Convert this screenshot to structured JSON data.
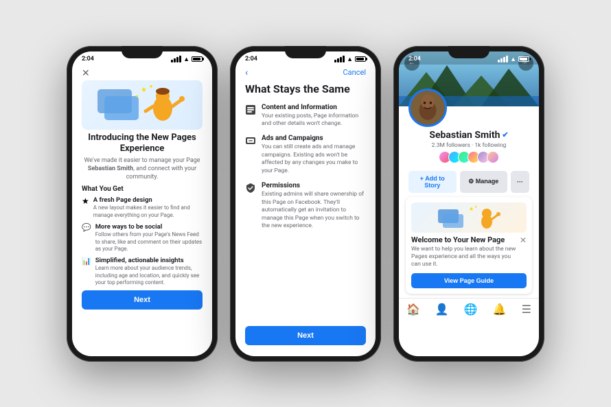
{
  "background": "#e8e8e8",
  "phone1": {
    "time": "2:04",
    "close_icon": "✕",
    "title": "Introducing the New Pages Experience",
    "subtitle_parts": [
      "We've made it easier to manage your Page",
      " Sebastian Smith",
      ", and connect with your community."
    ],
    "section_heading": "What You Get",
    "features": [
      {
        "icon": "★",
        "title": "A fresh Page design",
        "desc": "A new layout makes it easier to find and manage everything on your Page."
      },
      {
        "icon": "💬",
        "title": "More ways to be social",
        "desc": "Follow others from your Page's News Feed to share, like and comment on their updates as your Page."
      },
      {
        "icon": "📊",
        "title": "Simplified, actionable insights",
        "desc": "Learn more about your audience trends, including age and location, and quickly see your top performing content."
      }
    ],
    "next_btn": "Next"
  },
  "phone2": {
    "time": "2:04",
    "back_icon": "‹",
    "cancel_label": "Cancel",
    "title": "What Stays the Same",
    "items": [
      {
        "icon": "▤",
        "title": "Content and Information",
        "desc": "Your existing posts, Page information and other details won't change."
      },
      {
        "icon": "▤",
        "title": "Ads and Campaigns",
        "desc": "You can still create ads and manage campaigns. Existing ads won't be affected by any changes you make to your Page."
      },
      {
        "icon": "🛡",
        "title": "Permissions",
        "desc": "Existing admins will share ownership of this Page on Facebook. They'll automatically get an invitation to manage this Page when you switch to the new experience."
      }
    ],
    "next_btn": "Next"
  },
  "phone3": {
    "time": "2:04",
    "back_icon": "←",
    "search_icon": "🔍",
    "profile_name": "Sebastian Smith",
    "verified": true,
    "followers": "2.3M followers",
    "following": "1k following",
    "add_story_label": "+ Add to Story",
    "manage_label": "⚙ Manage",
    "more_icon": "···",
    "welcome_card": {
      "close_icon": "✕",
      "title": "Welcome to Your New Page",
      "text": "We want to help you learn about the new Pages experience and all the ways you can use it.",
      "btn_label": "View Page Guide"
    },
    "nav_items": [
      "🏠",
      "👤",
      "🌐",
      "🔔",
      "☰"
    ]
  }
}
